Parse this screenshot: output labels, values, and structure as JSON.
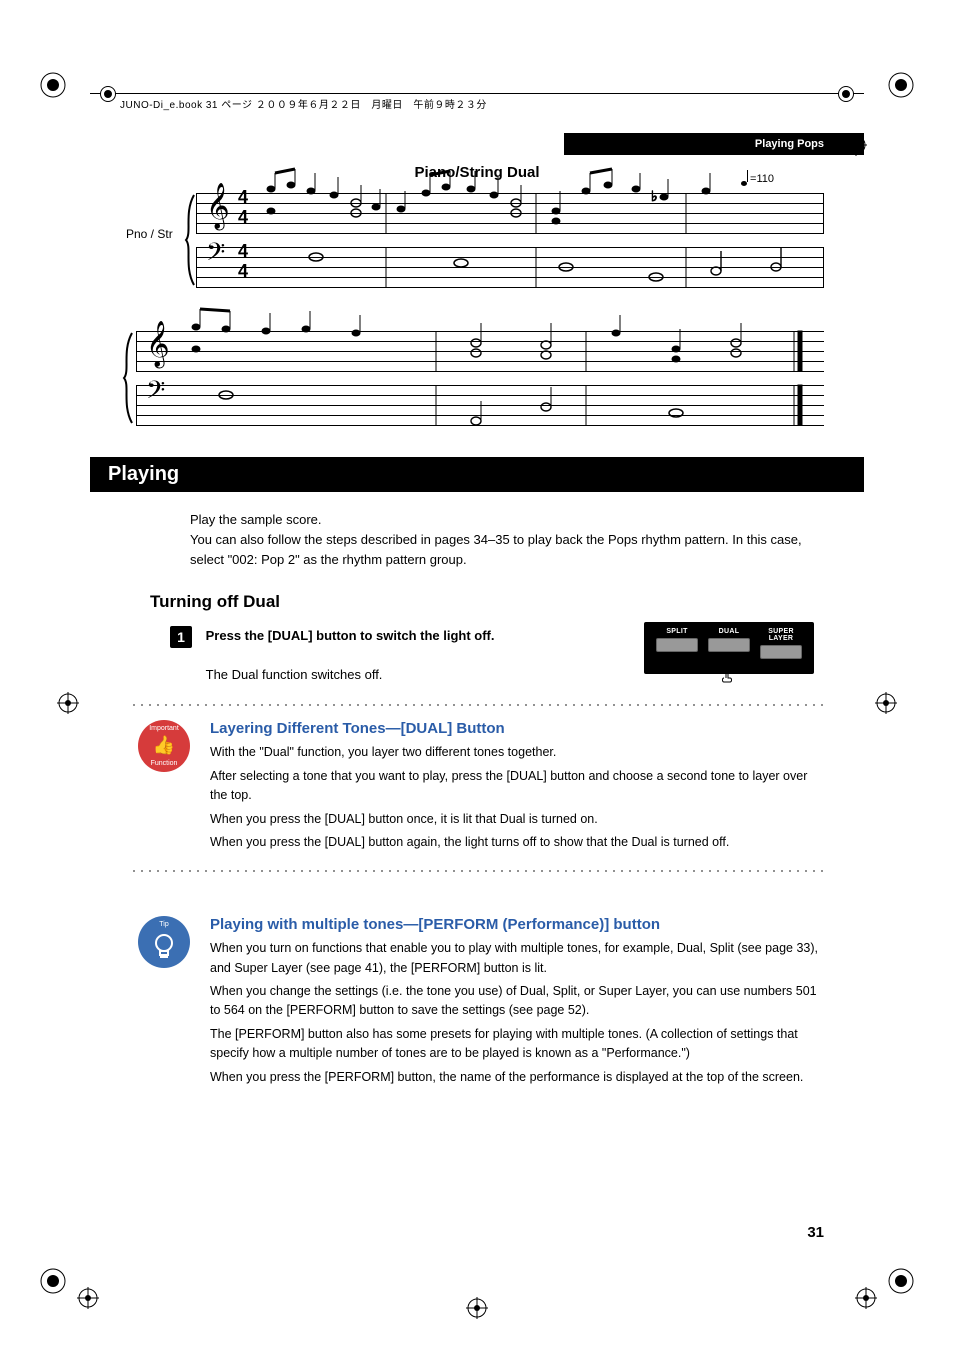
{
  "bookline": "JUNO-Di_e.book  31 ページ  ２００９年６月２２日　月曜日　午前９時２３分",
  "section_header": "Playing Pops",
  "score": {
    "title": "Piano/String Dual",
    "tempo": "=110",
    "instrument_label": "Pno / Str"
  },
  "playing": {
    "title": "Playing",
    "body_line1": "Play the sample score.",
    "body_line2": "You can also follow the steps described in pages 34–35 to play back the Pops rhythm pattern. In this case, select \"002: Pop 2\" as the rhythm pattern group."
  },
  "turning_off": {
    "title": "Turning off Dual",
    "step_num": "1",
    "step_bold": "Press the [DUAL] button to switch the light off.",
    "step_body": "The Dual function switches off.",
    "panel_buttons": [
      "SPLIT",
      "DUAL",
      "SUPER LAYER"
    ]
  },
  "layering": {
    "badge_top": "Important",
    "badge_bottom": "Function",
    "title": "Layering Different Tones—[DUAL] Button",
    "p1": "With the \"Dual\" function, you layer two different tones together.",
    "p2": "After selecting a tone that you want to play, press the [DUAL] button and choose a second tone to layer over the top.",
    "p3": "When you press the [DUAL] button once, it is lit that Dual is turned on.",
    "p4": "When you press the [DUAL] button again, the light turns off to show that the Dual is turned off."
  },
  "perform": {
    "badge_top": "Tip",
    "title": "Playing with multiple tones—[PERFORM (Performance)] button",
    "p1": "When you turn on functions that enable you to play with multiple tones, for example, Dual, Split (see page 33), and Super Layer (see page 41), the [PERFORM] button is lit.",
    "p2": "When you change the settings (i.e. the tone you use) of Dual, Split, or Super Layer, you can use numbers 501 to 564 on the [PERFORM] button to save the settings (see page 52).",
    "p3": "The [PERFORM] button also has some presets for playing with multiple tones. (A collection of settings that specify how a multiple number of tones are to be played is known as a \"Performance.\")",
    "p4": "When you press the [PERFORM] button, the name of the performance is displayed at the top of the screen."
  },
  "page_number": "31"
}
